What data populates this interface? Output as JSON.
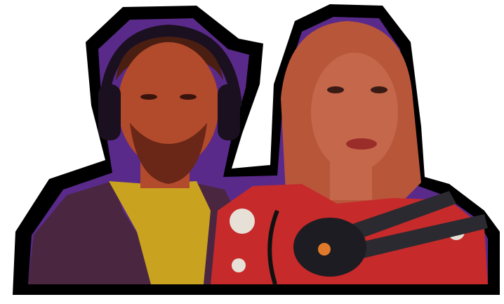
{
  "image": {
    "background": "#ffffff",
    "cutout_outline": "#000000",
    "backdrop_purple": "#5a2a8a",
    "man": {
      "skin": "#b24a2c",
      "hair": "#4a1f12",
      "beard": "#6a2616",
      "headphones": "#1a1020",
      "shirt": "#c9a21f",
      "hoodie": "#4a2640"
    },
    "woman": {
      "skin": "#c4674a",
      "hair": "#b8563a",
      "top": "#c62a2a",
      "microphone": "#1c1c22",
      "mic_arm": "#2a2a30"
    }
  }
}
